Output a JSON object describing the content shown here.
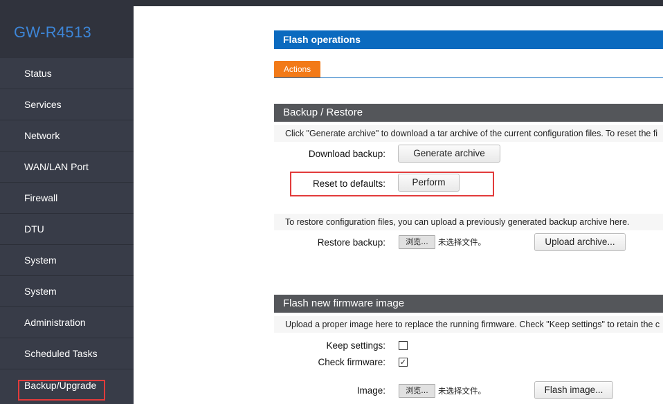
{
  "brand": "GW-R4513",
  "sidebar": {
    "items": [
      {
        "label": "Status"
      },
      {
        "label": "Services"
      },
      {
        "label": "Network"
      },
      {
        "label": "WAN/LAN Port"
      },
      {
        "label": "Firewall"
      },
      {
        "label": "DTU"
      },
      {
        "label": "System"
      },
      {
        "label": "System"
      },
      {
        "label": "Administration"
      },
      {
        "label": "Scheduled Tasks"
      },
      {
        "label": "Backup/Upgrade"
      }
    ]
  },
  "page": {
    "title": "Flash operations",
    "tab": "Actions"
  },
  "backup": {
    "heading": "Backup / Restore",
    "description": "Click \"Generate archive\" to download a tar archive of the current configuration files. To reset the fi",
    "download_label": "Download backup:",
    "generate_button": "Generate archive",
    "reset_label": "Reset to defaults:",
    "perform_button": "Perform",
    "restore_description": "To restore configuration files, you can upload a previously generated backup archive here.",
    "restore_label": "Restore backup:",
    "browse_button": "浏览...",
    "no_file": "未选择文件。",
    "upload_button": "Upload archive..."
  },
  "firmware": {
    "heading": "Flash new firmware image",
    "description": "Upload a proper image here to replace the running firmware. Check \"Keep settings\" to retain the c",
    "keep_label": "Keep settings:",
    "keep_checked": false,
    "check_label": "Check firmware:",
    "check_checked": true,
    "check_mark": "✓",
    "image_label": "Image:",
    "browse_button": "浏览...",
    "no_file": "未选择文件。",
    "flash_button": "Flash image..."
  }
}
